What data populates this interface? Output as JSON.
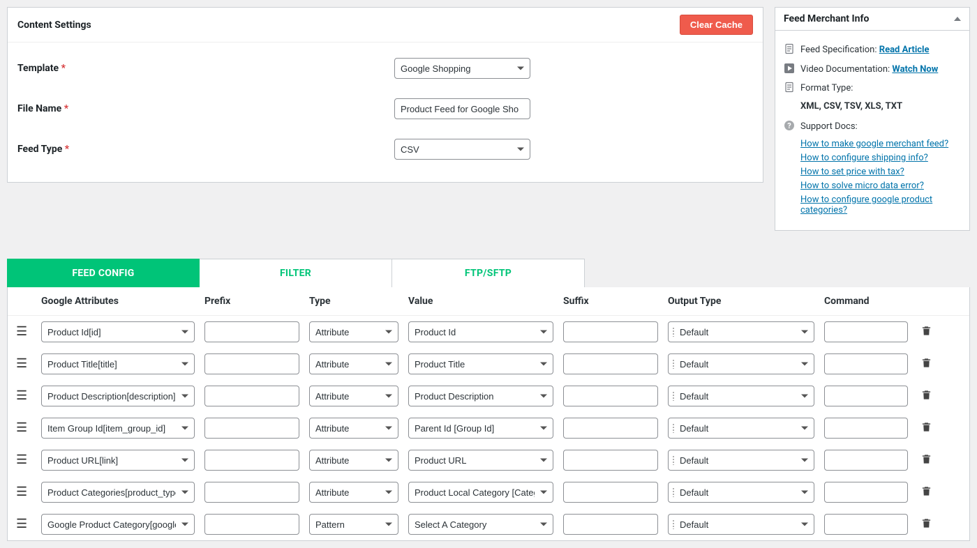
{
  "content_settings": {
    "title": "Content Settings",
    "clear_cache": "Clear Cache",
    "template_label": "Template",
    "template_value": "Google Shopping",
    "file_name_label": "File Name",
    "file_name_value": "Product Feed for Google Sho",
    "feed_type_label": "Feed Type",
    "feed_type_value": "CSV"
  },
  "merchant": {
    "title": "Feed Merchant Info",
    "spec_label": "Feed Specification:",
    "spec_link": "Read Article",
    "video_label": "Video Documentation:",
    "video_link": "Watch Now",
    "format_label": "Format Type:",
    "format_value": "XML, CSV, TSV, XLS, TXT",
    "support_label": "Support Docs:",
    "support_links": [
      "How to make google merchant feed?",
      "How to configure shipping info?",
      "How to set price with tax?",
      "How to solve micro data error?",
      "How to configure google product categories?"
    ]
  },
  "tabs": {
    "feed_config": "FEED CONFIG",
    "filter": "FILTER",
    "ftp": "FTP/SFTP"
  },
  "table": {
    "headers": {
      "attr": "Google Attributes",
      "prefix": "Prefix",
      "type": "Type",
      "value": "Value",
      "suffix": "Suffix",
      "output": "Output Type",
      "command": "Command"
    },
    "rows": [
      {
        "attr": "Product Id[id]",
        "type": "Attribute",
        "value": "Product Id",
        "output": "Default"
      },
      {
        "attr": "Product Title[title]",
        "type": "Attribute",
        "value": "Product Title",
        "output": "Default"
      },
      {
        "attr": "Product Description[description]",
        "type": "Attribute",
        "value": "Product Description",
        "output": "Default"
      },
      {
        "attr": "Item Group Id[item_group_id]",
        "type": "Attribute",
        "value": "Parent Id [Group Id]",
        "output": "Default"
      },
      {
        "attr": "Product URL[link]",
        "type": "Attribute",
        "value": "Product URL",
        "output": "Default"
      },
      {
        "attr": "Product Categories[product_type]",
        "type": "Attribute",
        "value": "Product Local Category [Category]",
        "output": "Default"
      },
      {
        "attr": "Google Product Category[google_product_category]",
        "type": "Pattern",
        "value": "Select A Category",
        "value_placeholder": true,
        "output": "Default"
      }
    ]
  }
}
